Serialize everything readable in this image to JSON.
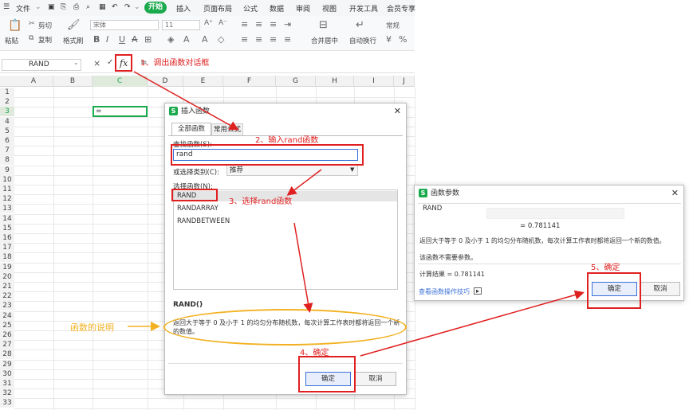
{
  "menubar": {
    "file": "文件",
    "start": "开始",
    "tabs": [
      "插入",
      "页面布局",
      "公式",
      "数据",
      "审阅",
      "视图",
      "开发工具",
      "会员专享"
    ]
  },
  "toolbar": {
    "paste": "粘贴",
    "cut": "剪切",
    "copy": "复制",
    "format_painter": "格式刷",
    "font_name": "宋体",
    "font_size": "11",
    "merge_center": "合并居中",
    "wrap_text": "自动换行",
    "number_format": "常规"
  },
  "formula_bar": {
    "name_box": "RAND",
    "cancel": "×",
    "confirm": "✓",
    "fx": "fx",
    "equals": "="
  },
  "grid": {
    "columns": [
      "A",
      "B",
      "C",
      "D",
      "E",
      "F",
      "G",
      "H",
      "I",
      "J"
    ],
    "rows": [
      "1",
      "2",
      "3",
      "4",
      "5",
      "6",
      "7",
      "8",
      "9",
      "10",
      "11",
      "12",
      "13",
      "14",
      "15",
      "16",
      "17",
      "18",
      "19",
      "20",
      "21",
      "22",
      "23",
      "24",
      "25",
      "26",
      "27",
      "28",
      "29",
      "30",
      "31",
      "32",
      "33"
    ],
    "active_cell_value": "="
  },
  "insert_dialog": {
    "title": "插入函数",
    "tab_all": "全部函数",
    "tab_common": "常用公式",
    "search_label": "查找函数(S):",
    "search_value": "rand",
    "category_label": "或选择类别(C):",
    "category_value": "推荐",
    "select_label": "选择函数(N):",
    "functions": [
      "RAND",
      "RANDARRAY",
      "RANDBETWEEN"
    ],
    "signature": "RAND()",
    "description": "返回大于等于 0 及小于 1 的均匀分布随机数，每次计算工作表时都将返回一个新的数值。",
    "ok": "确定",
    "cancel": "取消"
  },
  "args_dialog": {
    "title": "函数参数",
    "func_name": "RAND",
    "result_line": "= 0.781141",
    "description": "返回大于等于 0 及小于 1 的均匀分布随机数，每次计算工作表时都将返回一个新的数值。",
    "no_params": "该函数不需要参数。",
    "calc_result": "计算结果 = 0.781141",
    "tips_link": "查看函数操作技巧",
    "ok": "确定",
    "cancel": "取消"
  },
  "annotations": {
    "step1": "1、调出函数对话框",
    "step2": "2、输入rand函数",
    "step3": "3、选择rand函数",
    "step4": "4、确定",
    "step5": "5、确定",
    "desc_note": "函数的说明"
  },
  "colors": {
    "accent_green": "#1aa94c",
    "annotation_red": "#e02020",
    "annotation_orange": "#f2b122",
    "selection_blue": "#3a6fd8"
  }
}
